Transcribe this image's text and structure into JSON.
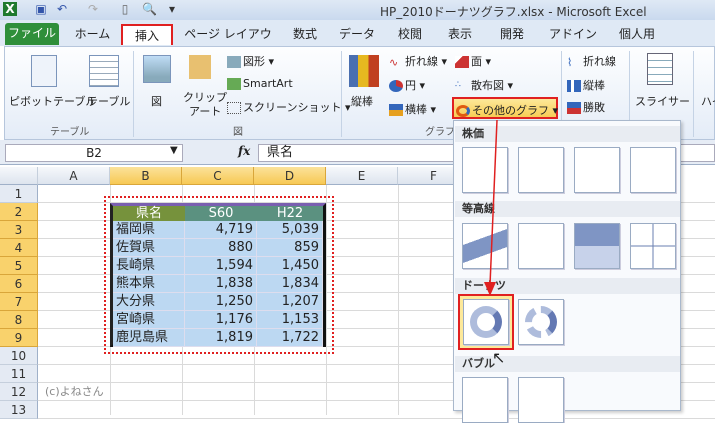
{
  "window": {
    "title": "HP_2010ドーナツグラフ.xlsx - Microsoft Excel"
  },
  "quick_access": {
    "save": "save-icon",
    "undo": "undo-icon",
    "redo": "redo-icon",
    "new": "new-icon",
    "preview": "print-preview-icon",
    "customize": "customize-icon"
  },
  "tabs": [
    "ファイル",
    "ホーム",
    "挿入",
    "ページ レイアウト",
    "数式",
    "データ",
    "校閲",
    "表示",
    "開発",
    "アドイン",
    "個人用"
  ],
  "ribbon": {
    "pivot": "ピボットテーブル",
    "table": "テーブル",
    "group_table": "テーブル",
    "picture": "図",
    "clipart1": "クリップ",
    "clipart2": "アート",
    "shapes": "図形",
    "smartart": "SmartArt",
    "screenshot": "スクリーンショット",
    "group_illust": "図",
    "column": "縦棒",
    "line": "折れ線",
    "pie": "円",
    "bar": "横棒",
    "area": "面",
    "scatter": "散布図",
    "other": "その他のグラフ",
    "group_chart": "グラフ",
    "spark_line": "折れ線",
    "spark_column": "縦棒",
    "spark_winloss": "勝敗",
    "slicer": "スライサー",
    "hyperlink": "ハイ"
  },
  "formula_bar": {
    "name_box": "B2",
    "fx": "fx",
    "value": "県名"
  },
  "columns": [
    "A",
    "B",
    "C",
    "D",
    "E",
    "F"
  ],
  "rows": [
    "1",
    "2",
    "3",
    "4",
    "5",
    "6",
    "7",
    "8",
    "9",
    "10",
    "11",
    "12",
    "13"
  ],
  "table": {
    "headers": [
      "県名",
      "S60",
      "H22"
    ],
    "rows": [
      [
        "福岡県",
        "4,719",
        "5,039"
      ],
      [
        "佐賀県",
        "880",
        "859"
      ],
      [
        "長崎県",
        "1,594",
        "1,450"
      ],
      [
        "熊本県",
        "1,838",
        "1,834"
      ],
      [
        "大分県",
        "1,250",
        "1,207"
      ],
      [
        "宮崎県",
        "1,176",
        "1,153"
      ],
      [
        "鹿児島県",
        "1,819",
        "1,722"
      ]
    ]
  },
  "credit": "(c)よねさん",
  "menu": {
    "sections": [
      "株価",
      "等高線",
      "ドーナツ",
      "バブル"
    ]
  },
  "colors": {
    "accent": "#e02020",
    "header_green": "#76923c",
    "header_teal": "#5b9180",
    "cell_blue": "#bcd8f2"
  }
}
